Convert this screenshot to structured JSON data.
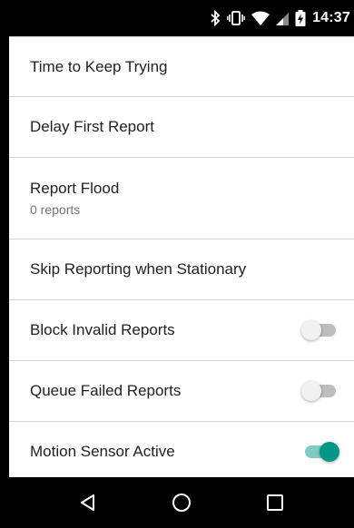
{
  "status_bar": {
    "time": "14:37",
    "icons": [
      "bluetooth-icon",
      "vibrate-icon",
      "wifi-icon",
      "cell-signal-icon",
      "battery-charging-icon"
    ]
  },
  "settings": {
    "items": [
      {
        "title": "Time to Keep Trying"
      },
      {
        "title": "Delay First Report"
      },
      {
        "title": "Report Flood",
        "summary": "0 reports"
      },
      {
        "title": "Skip Reporting when Stationary"
      },
      {
        "title": "Block Invalid Reports",
        "switch": false
      },
      {
        "title": "Queue Failed Reports",
        "switch": false
      },
      {
        "title": "Motion Sensor Active",
        "switch": true
      }
    ]
  },
  "nav_bar": {
    "buttons": [
      "back-icon",
      "home-icon",
      "recents-icon"
    ]
  },
  "colors": {
    "accent": "#009688",
    "accent_track": "#80cbc4",
    "divider": "#cfd8dc"
  }
}
